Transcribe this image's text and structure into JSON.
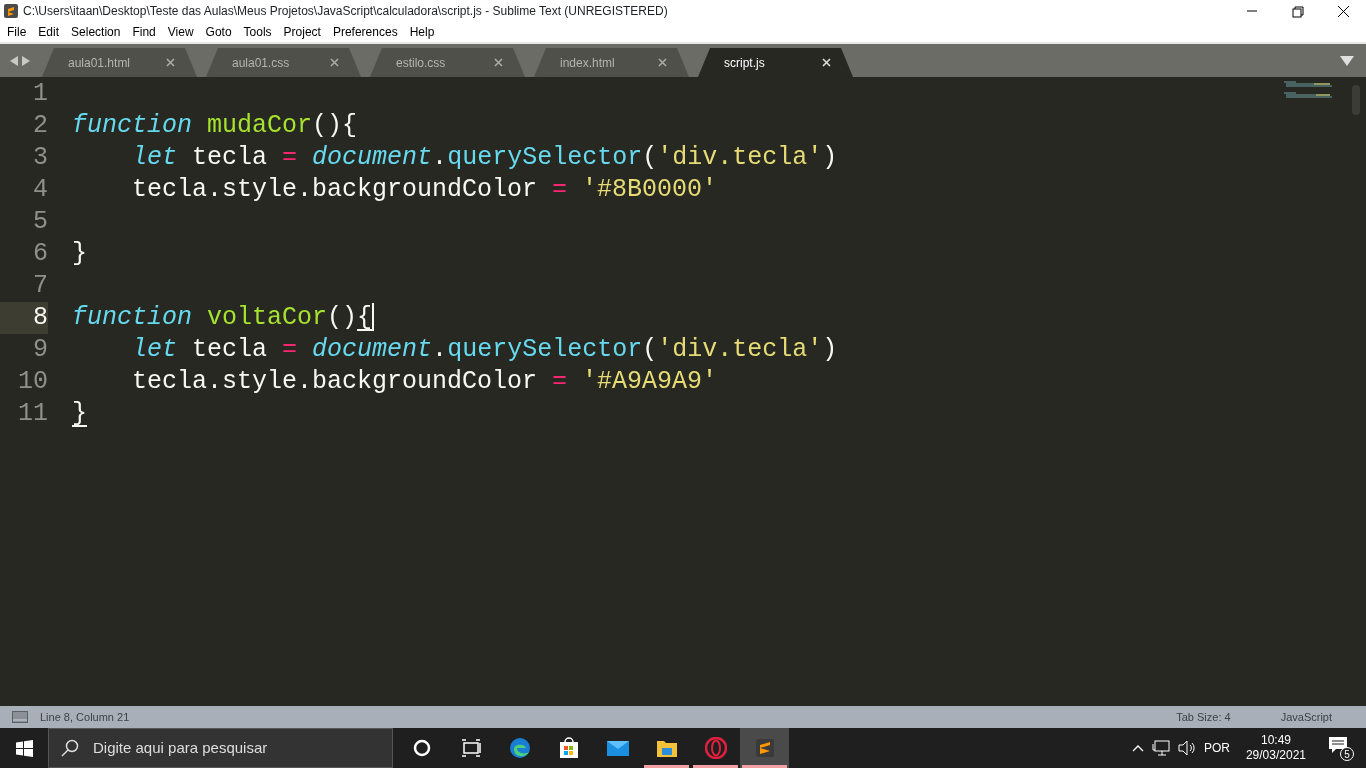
{
  "window": {
    "title": "C:\\Users\\itaan\\Desktop\\Teste das Aulas\\Meus Projetos\\JavaScript\\calculadora\\script.js - Sublime Text (UNREGISTERED)"
  },
  "menu": [
    "File",
    "Edit",
    "Selection",
    "Find",
    "View",
    "Goto",
    "Tools",
    "Project",
    "Preferences",
    "Help"
  ],
  "tabs": [
    {
      "label": "aula01.html",
      "selected": false
    },
    {
      "label": "aula01.css",
      "selected": false
    },
    {
      "label": "estilo.css",
      "selected": false
    },
    {
      "label": "index.html",
      "selected": false
    },
    {
      "label": "script.js",
      "selected": true
    }
  ],
  "editor": {
    "lines": [
      {
        "number": "1",
        "current": false
      },
      {
        "number": "2",
        "current": false,
        "tokens": [
          {
            "text": "function",
            "kind": "keyword"
          },
          {
            "text": " mudaCor",
            "kind": "name"
          },
          {
            "text": "(){",
            "kind": "plain"
          }
        ]
      },
      {
        "number": "3",
        "current": false,
        "tokens": [
          {
            "text": "    let",
            "kind": "keyword"
          },
          {
            "text": " tecla ",
            "kind": "plain"
          },
          {
            "text": "=",
            "kind": "operator"
          },
          {
            "text": " document",
            "kind": "keyword"
          },
          {
            "text": ".",
            "kind": "plain"
          },
          {
            "text": "querySelector",
            "kind": "method"
          },
          {
            "text": "(",
            "kind": "plain"
          },
          {
            "text": "'div.tecla'",
            "kind": "string"
          },
          {
            "text": ")",
            "kind": "plain"
          }
        ]
      },
      {
        "number": "4",
        "current": false,
        "tokens": [
          {
            "text": "    tecla.style.backgroundColor ",
            "kind": "plain"
          },
          {
            "text": "=",
            "kind": "operator"
          },
          {
            "text": " '#8B0000'",
            "kind": "string"
          }
        ]
      },
      {
        "number": "5",
        "current": false
      },
      {
        "number": "6",
        "current": false,
        "tokens": [
          {
            "text": "}",
            "kind": "plain"
          }
        ]
      },
      {
        "number": "7",
        "current": false
      },
      {
        "number": "8",
        "current": true,
        "tokens": [
          {
            "text": "function",
            "kind": "keyword"
          },
          {
            "text": " voltaCor",
            "kind": "name"
          },
          {
            "text": "()",
            "kind": "plain"
          },
          {
            "text": "{",
            "kind": "matched"
          }
        ]
      },
      {
        "number": "9",
        "current": false,
        "tokens": [
          {
            "text": "    let",
            "kind": "keyword"
          },
          {
            "text": " tecla ",
            "kind": "plain"
          },
          {
            "text": "=",
            "kind": "operator"
          },
          {
            "text": " document",
            "kind": "keyword"
          },
          {
            "text": ".",
            "kind": "plain"
          },
          {
            "text": "querySelector",
            "kind": "method"
          },
          {
            "text": "(",
            "kind": "plain"
          },
          {
            "text": "'div.tecla'",
            "kind": "string"
          },
          {
            "text": ")",
            "kind": "plain"
          }
        ]
      },
      {
        "number": "10",
        "current": false,
        "tokens": [
          {
            "text": "    tecla.style.backgroundColor ",
            "kind": "plain"
          },
          {
            "text": "=",
            "kind": "operator"
          },
          {
            "text": " '#A9A9A9'",
            "kind": "string"
          }
        ]
      },
      {
        "number": "11",
        "current": false,
        "tokens": [
          {
            "text": "}",
            "kind": "matched"
          }
        ]
      }
    ]
  },
  "status_bar": {
    "position": "Line 8, Column 21",
    "tab_size": "Tab Size: 4",
    "syntax": "JavaScript"
  },
  "taskbar": {
    "search_placeholder": "Digite aqui para pesquisar",
    "apps": [
      {
        "kind": "cortana",
        "running": false,
        "selected": false
      },
      {
        "kind": "taskview",
        "running": false,
        "selected": false
      },
      {
        "kind": "edge",
        "running": false,
        "selected": false
      },
      {
        "kind": "store",
        "running": false,
        "selected": false
      },
      {
        "kind": "mail",
        "running": false,
        "selected": false
      },
      {
        "kind": "folder",
        "running": true,
        "selected": false
      },
      {
        "kind": "opera",
        "running": true,
        "selected": false
      },
      {
        "kind": "sublime",
        "running": true,
        "selected": true
      }
    ],
    "language": "POR",
    "time": "10:49",
    "date": "29/03/2021",
    "notifications": "5"
  }
}
